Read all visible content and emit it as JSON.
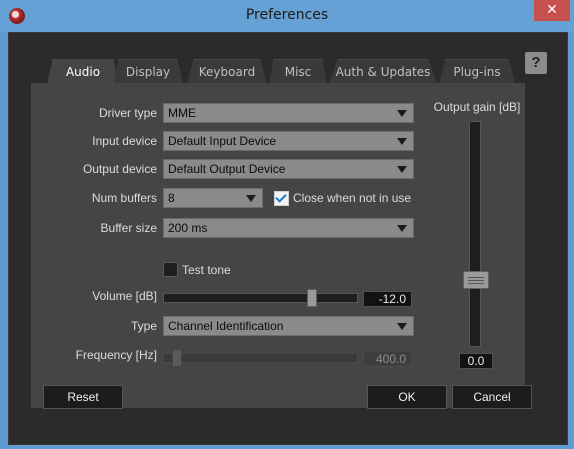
{
  "window": {
    "title": "Preferences",
    "close_glyph": "✕",
    "help_glyph": "?"
  },
  "tabs": [
    {
      "label": "Audio",
      "active": true
    },
    {
      "label": "Display",
      "active": false
    },
    {
      "label": "Keyboard",
      "active": false
    },
    {
      "label": "Misc",
      "active": false
    },
    {
      "label": "Auth & Updates",
      "active": false
    },
    {
      "label": "Plug-ins",
      "active": false
    }
  ],
  "audio": {
    "driver_type": {
      "label": "Driver type",
      "value": "MME"
    },
    "input_device": {
      "label": "Input device",
      "value": "Default Input Device"
    },
    "output_device": {
      "label": "Output device",
      "value": "Default Output Device"
    },
    "num_buffers": {
      "label": "Num buffers",
      "value": "8"
    },
    "close_when_not_in_use": {
      "label": "Close when not in use",
      "checked": true
    },
    "buffer_size": {
      "label": "Buffer size",
      "value": "200 ms"
    },
    "test_tone": {
      "label": "Test tone",
      "checked": false
    },
    "volume": {
      "label": "Volume [dB]",
      "value": "-12.0",
      "slider_fraction": 0.78
    },
    "type": {
      "label": "Type",
      "value": "Channel Identification"
    },
    "frequency": {
      "label": "Frequency [Hz]",
      "value": "400.0",
      "slider_fraction": 0.05,
      "enabled": false
    },
    "output_gain": {
      "label": "Output gain [dB]",
      "value": "0.0",
      "slider_fraction": 0.72
    }
  },
  "buttons": {
    "reset": "Reset",
    "ok": "OK",
    "cancel": "Cancel"
  },
  "colors": {
    "accent_check": "#1a7ad0",
    "panel_bg": "#454545",
    "close_button": "#c75050"
  }
}
